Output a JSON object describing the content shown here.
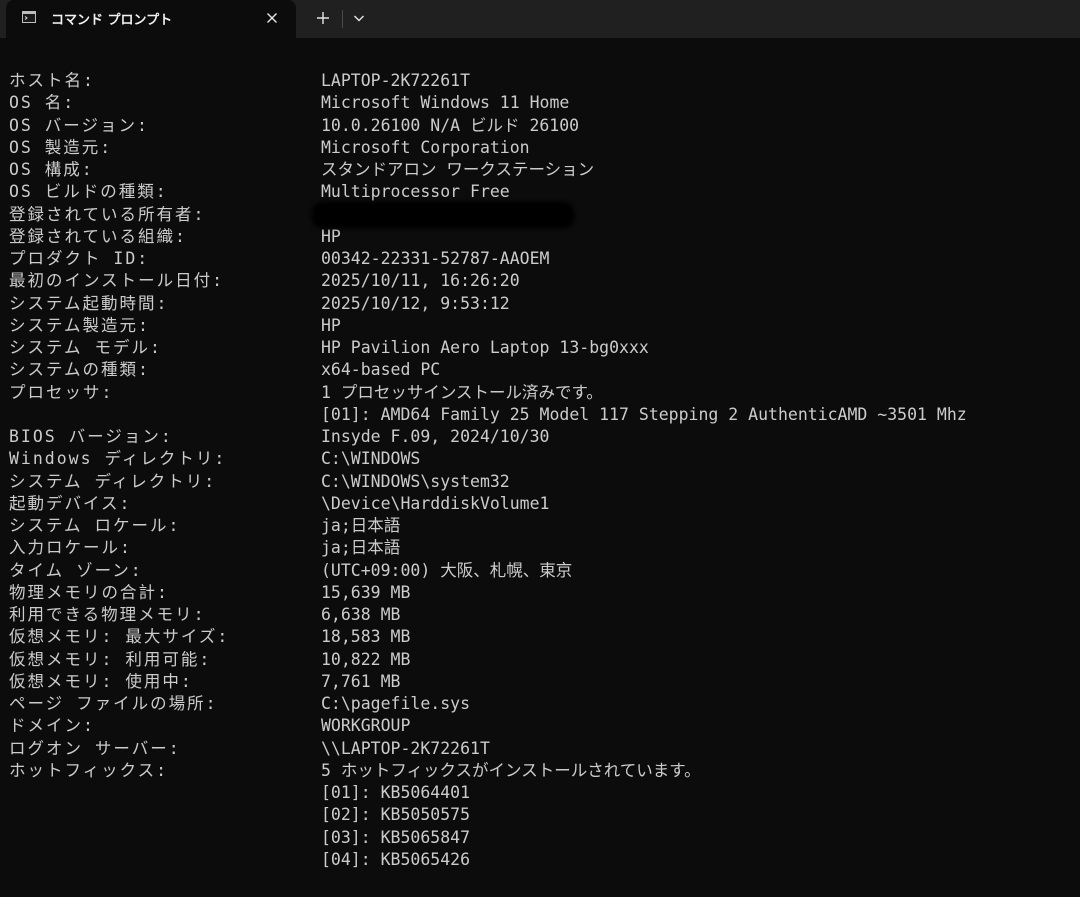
{
  "window": {
    "tab_title": "コマンド プロンプト",
    "tab_icon": "terminal-icon",
    "icons": {
      "close": "close-icon",
      "new_tab": "plus-icon",
      "dropdown": "chevron-down-icon"
    }
  },
  "colors": {
    "background": "#0c0c0c",
    "tabbar": "#202020",
    "text": "#cccccc"
  },
  "systeminfo": [
    {
      "label": "ホスト名:",
      "value": "LAPTOP-2K72261T"
    },
    {
      "label": "OS 名:",
      "value": "Microsoft Windows 11 Home"
    },
    {
      "label": "OS バージョン:",
      "value": "10.0.26100 N/A ビルド 26100"
    },
    {
      "label": "OS 製造元:",
      "value": "Microsoft Corporation"
    },
    {
      "label": "OS 構成:",
      "value": "スタンドアロン ワークステーション"
    },
    {
      "label": "OS ビルドの種類:",
      "value": "Multiprocessor Free"
    },
    {
      "label": "登録されている所有者:",
      "value": ""
    },
    {
      "label": "登録されている組織:",
      "value": "HP"
    },
    {
      "label": "プロダクト ID:",
      "value": "00342-22331-52787-AAOEM"
    },
    {
      "label": "最初のインストール日付:",
      "value": "2025/10/11, 16:26:20"
    },
    {
      "label": "システム起動時間:",
      "value": "2025/10/12, 9:53:12"
    },
    {
      "label": "システム製造元:",
      "value": "HP"
    },
    {
      "label": "システム モデル:",
      "value": "HP Pavilion Aero Laptop 13-bg0xxx"
    },
    {
      "label": "システムの種類:",
      "value": "x64-based PC"
    },
    {
      "label": "プロセッサ:",
      "value": "1 プロセッサインストール済みです。"
    },
    {
      "label": "",
      "value": "[01]: AMD64 Family 25 Model 117 Stepping 2 AuthenticAMD ~3501 Mhz"
    },
    {
      "label": "BIOS バージョン:",
      "value": "Insyde F.09, 2024/10/30"
    },
    {
      "label": "Windows ディレクトリ:",
      "value": "C:\\WINDOWS"
    },
    {
      "label": "システム ディレクトリ:",
      "value": "C:\\WINDOWS\\system32"
    },
    {
      "label": "起動デバイス:",
      "value": "\\Device\\HarddiskVolume1"
    },
    {
      "label": "システム ロケール:",
      "value": "ja;日本語"
    },
    {
      "label": "入力ロケール:",
      "value": "ja;日本語"
    },
    {
      "label": "タイム ゾーン:",
      "value": "(UTC+09:00) 大阪、札幌、東京"
    },
    {
      "label": "物理メモリの合計:",
      "value": "15,639 MB"
    },
    {
      "label": "利用できる物理メモリ:",
      "value": "6,638 MB"
    },
    {
      "label": "仮想メモリ: 最大サイズ:",
      "value": "18,583 MB"
    },
    {
      "label": "仮想メモリ: 利用可能:",
      "value": "10,822 MB"
    },
    {
      "label": "仮想メモリ: 使用中:",
      "value": "7,761 MB"
    },
    {
      "label": "ページ ファイルの場所:",
      "value": "C:\\pagefile.sys"
    },
    {
      "label": "ドメイン:",
      "value": "WORKGROUP"
    },
    {
      "label": "ログオン サーバー:",
      "value": "\\\\LAPTOP-2K72261T"
    },
    {
      "label": "ホットフィックス:",
      "value": "5 ホットフィックスがインストールされています。"
    },
    {
      "label": "",
      "value": "[01]: KB5064401"
    },
    {
      "label": "",
      "value": "[02]: KB5050575"
    },
    {
      "label": "",
      "value": "[03]: KB5065847"
    },
    {
      "label": "",
      "value": "[04]: KB5065426"
    }
  ]
}
